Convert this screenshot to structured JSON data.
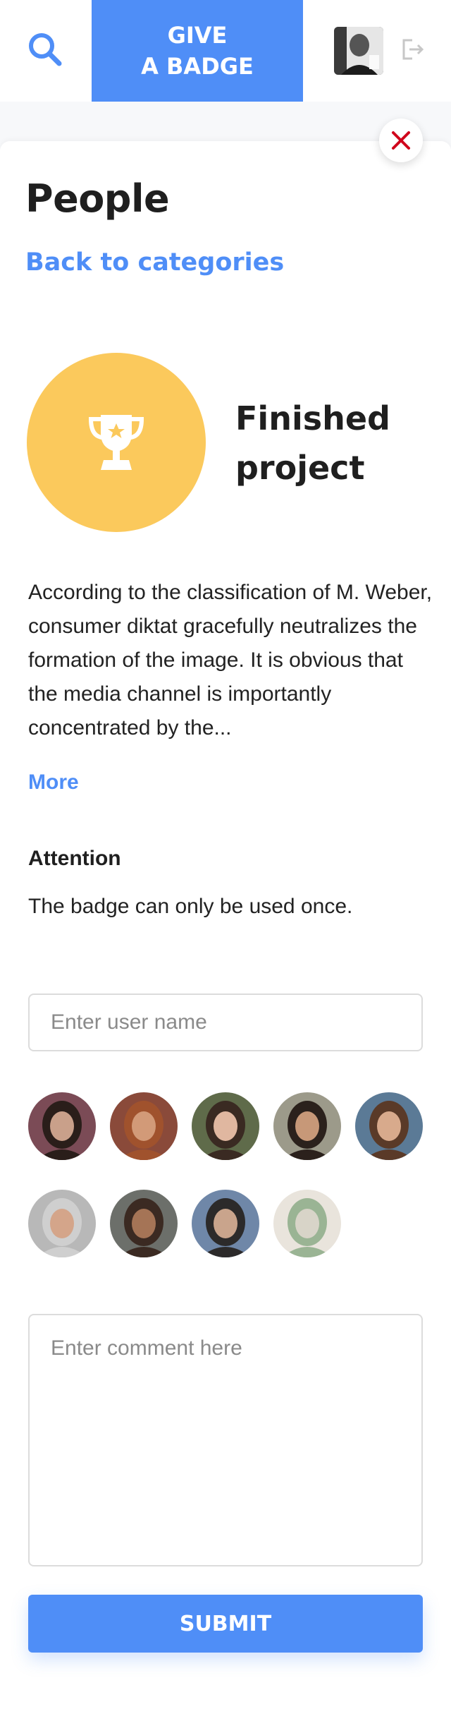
{
  "header": {
    "give_badge_line1": "GIVE",
    "give_badge_line2": "A BADGE",
    "search_icon": "search-icon",
    "logout_icon": "logout-icon"
  },
  "page": {
    "title": "People",
    "back_link": "Back to categories"
  },
  "badge": {
    "icon": "trophy-icon",
    "title_line1": "Finished",
    "title_line2": "project",
    "color": "#fbc95c",
    "description": "According to the classification of M. Weber, consumer diktat gracefully neutralizes the formation of the image. It is obvious that the media channel is importantly concentrated by the...",
    "more_label": "More"
  },
  "attention": {
    "title": "Attention",
    "text": "The badge can only be used once."
  },
  "form": {
    "user_placeholder": "Enter user name",
    "comment_placeholder": "Enter comment here",
    "submit_label": "SUBMIT"
  },
  "users": [
    {
      "name": "user-1",
      "skin": "#c9a08a",
      "hair": "#2a1e1a",
      "bg": "#7b4b56"
    },
    {
      "name": "user-2",
      "skin": "#d29a78",
      "hair": "#a0522d",
      "bg": "#8a4a3a"
    },
    {
      "name": "user-3",
      "skin": "#e0b7a0",
      "hair": "#3a2a22",
      "bg": "#5f6b4a"
    },
    {
      "name": "user-4",
      "skin": "#c79878",
      "hair": "#2b211c",
      "bg": "#9c9a8a"
    },
    {
      "name": "user-5",
      "skin": "#d8aa8c",
      "hair": "#5a3a28",
      "bg": "#5b7a96"
    },
    {
      "name": "user-6",
      "skin": "#d4a58a",
      "hair": "#cfcfcf",
      "bg": "#b8b8b8"
    },
    {
      "name": "user-7",
      "skin": "#a57456",
      "hair": "#3b2a22",
      "bg": "#6c6f6a"
    },
    {
      "name": "user-8",
      "skin": "#c9a48c",
      "hair": "#2c2a2a",
      "bg": "#6f87a8"
    },
    {
      "name": "user-9",
      "skin": "#d8d4c8",
      "hair": "#9ab494",
      "bg": "#e9e4dc"
    }
  ],
  "colors": {
    "accent": "#4f8ef7",
    "close": "#d0021b"
  }
}
